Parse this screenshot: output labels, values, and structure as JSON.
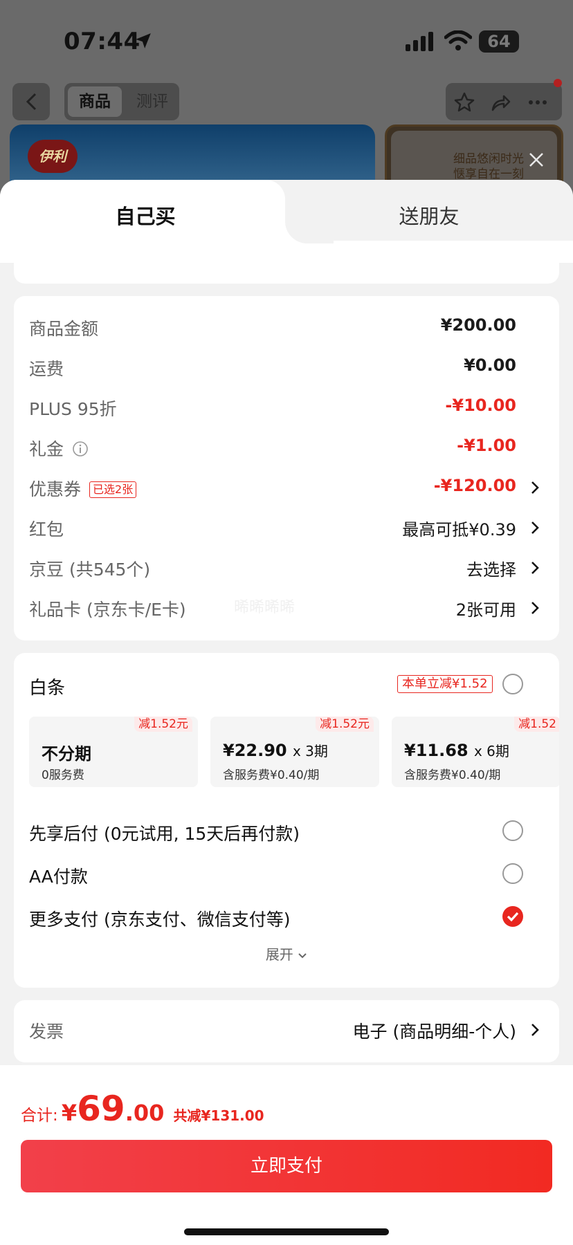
{
  "status_bar": {
    "time": "07:44",
    "battery": "64"
  },
  "nav": {
    "tab_product": "商品",
    "tab_review": "测评"
  },
  "banner": {
    "brand_logo": "伊利",
    "side_text_line1": "细品悠闲时光",
    "side_text_line2": "惬享自在一刻"
  },
  "sheet_tabs": {
    "self": "自己买",
    "friend": "送朋友"
  },
  "summary": {
    "rows": [
      {
        "label": "商品金额",
        "value": "¥200.00"
      },
      {
        "label": "运费",
        "value": "¥0.00"
      },
      {
        "label": "PLUS 95折",
        "value": "-¥10.00"
      },
      {
        "label": "礼金",
        "value": "-¥1.00"
      },
      {
        "label": "优惠券",
        "badge": "已选2张",
        "value": "-¥120.00"
      },
      {
        "label": "红包",
        "value": "最高可抵¥0.39"
      },
      {
        "label": "京豆 (共545个)",
        "value": "去选择"
      },
      {
        "label": "礼品卡 (京东卡/E卡)",
        "value": "2张可用"
      }
    ],
    "watermark": "晞晞晞晞"
  },
  "payment": {
    "baitiao_title": "白条",
    "baitiao_badge": "本单立减¥1.52",
    "plans": [
      {
        "tag": "减1.52元",
        "main": "不分期",
        "sub": "0服务费"
      },
      {
        "tag": "减1.52元",
        "main": "¥22.90",
        "times": "x 3期",
        "sub": "含服务费¥0.40/期"
      },
      {
        "tag": "减1.52",
        "main": "¥11.68",
        "times": "x 6期",
        "sub": "含服务费¥0.40/期"
      }
    ],
    "options": [
      {
        "label": "先享后付 (0元试用, 15天后再付款)",
        "selected": false
      },
      {
        "label": "AA付款",
        "selected": false
      },
      {
        "label": "更多支付 (京东支付、微信支付等)",
        "selected": true
      }
    ],
    "expand": "展开"
  },
  "invoice": {
    "label": "发票",
    "value": "电子 (商品明细-个人)"
  },
  "footer": {
    "total_label": "合计:",
    "currency": "¥",
    "total_integer": "69",
    "total_decimal": ".00",
    "total_saving": "共减¥131.00",
    "pay_button": "立即支付"
  },
  "colors": {
    "accent": "#e8261f",
    "pay_button": "#f2404a"
  }
}
